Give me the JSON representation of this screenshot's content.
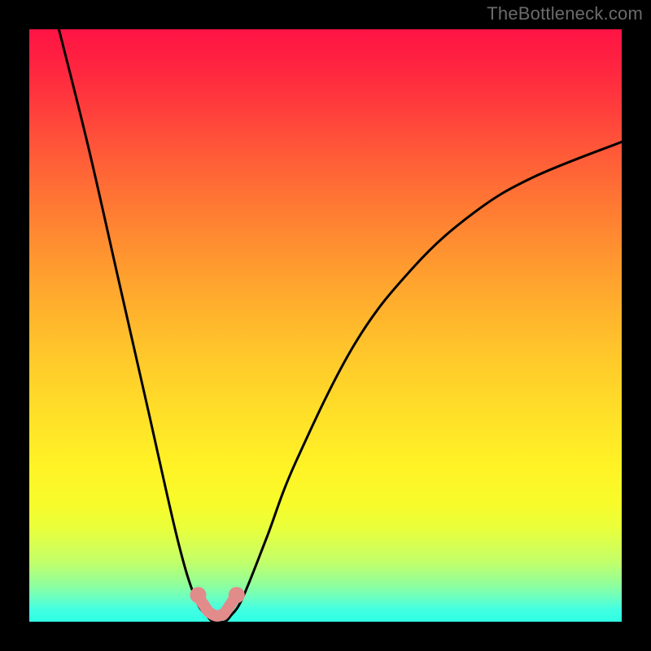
{
  "watermark": "TheBottleneck.com",
  "chart_data": {
    "type": "line",
    "title": "",
    "xlabel": "",
    "ylabel": "",
    "xlim": [
      0,
      100
    ],
    "ylim": [
      0,
      100
    ],
    "grid": false,
    "legend": false,
    "series": [
      {
        "name": "bottleneck-curve",
        "color": "#000000",
        "x": [
          5,
          10,
          15,
          20,
          25,
          28,
          30,
          31,
          32,
          33,
          34,
          36,
          40,
          45,
          55,
          65,
          75,
          85,
          100
        ],
        "y": [
          100,
          80,
          58,
          36,
          14,
          4,
          1,
          0,
          0,
          0,
          1,
          4,
          14,
          27,
          47,
          60,
          69,
          75,
          81
        ]
      },
      {
        "name": "highlight-pink",
        "color": "#e28b8b",
        "x": [
          28.5,
          29.0,
          29.5,
          30.0,
          30.5,
          31.0,
          31.5,
          32.0,
          32.5,
          33.0,
          35.0
        ],
        "y": [
          4.5,
          3.5,
          2.8,
          2.0,
          1.5,
          1.2,
          1.0,
          1.0,
          1.2,
          1.5,
          4.5
        ]
      }
    ],
    "gradient_stops": [
      {
        "pos": 0.0,
        "color": "#ff1344"
      },
      {
        "pos": 0.3,
        "color": "#ff7a33"
      },
      {
        "pos": 0.66,
        "color": "#ffe228"
      },
      {
        "pos": 0.86,
        "color": "#d7ff52"
      },
      {
        "pos": 1.0,
        "color": "#2fffe3"
      }
    ],
    "min_point": {
      "x": 31.5,
      "y": 0
    }
  }
}
